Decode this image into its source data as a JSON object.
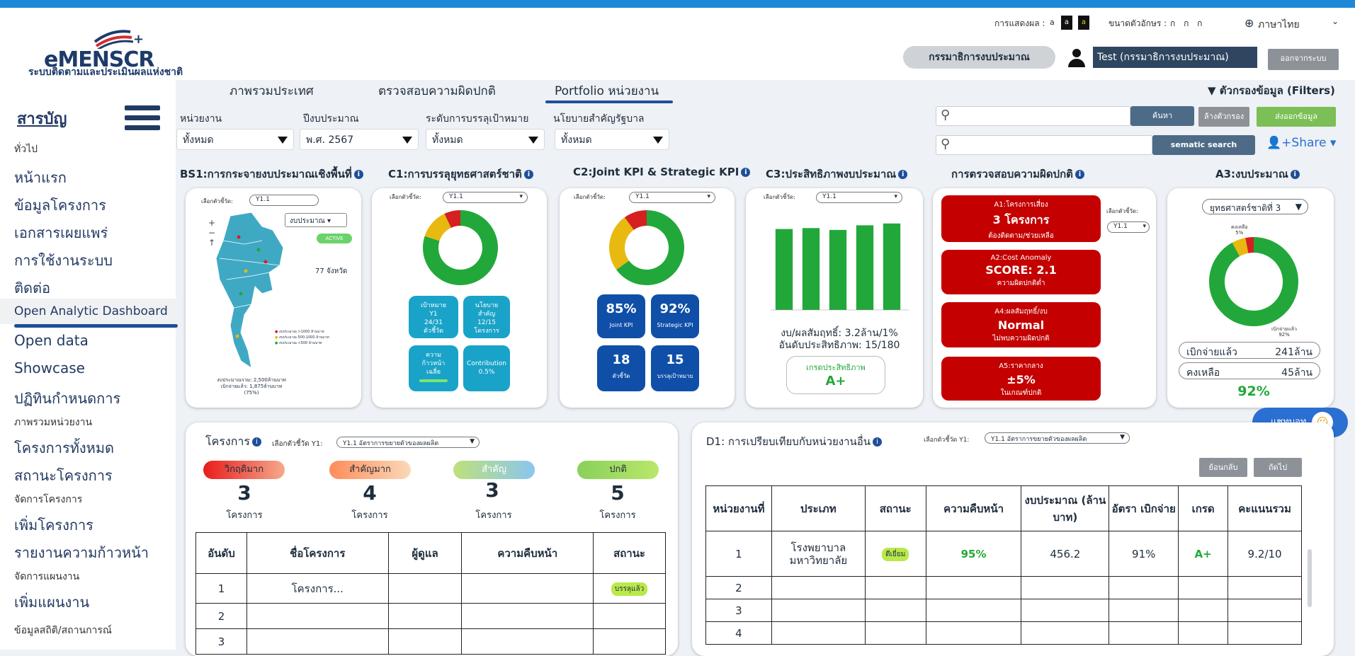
{
  "header": {
    "logo_text": "eMENSCR",
    "logo_sub": "ระบบติดตามและประเมินผลแห่งชาติ",
    "display_label": "การแสดงผล :",
    "fontsize_label": "ขนาดตัวอักษร :",
    "fontsize_options": "ก ก ก",
    "display_options": [
      "a",
      "a",
      "a"
    ],
    "language": "ภาษาไทย",
    "role_pill": "กรรมาธิการงบประมาณ",
    "user_name": "Test (กรรมาธิการงบประมาณ)",
    "logout": "ออกจากระบบ"
  },
  "sidebar": {
    "title": "สารบัญ",
    "items": [
      {
        "label": "ทั่วไป",
        "small": true
      },
      {
        "label": "หน้าแรก"
      },
      {
        "label": "ข้อมูลโครงการ"
      },
      {
        "label": "เอกสารเผยแพร่"
      },
      {
        "label": "การใช้งานระบบ"
      },
      {
        "label": "ติดต่อ"
      },
      {
        "label": "Open Analytic Dashboard",
        "active": true
      },
      {
        "label": "Open data"
      },
      {
        "label": "Showcase"
      },
      {
        "label": "ปฏิทินกำหนดการ"
      },
      {
        "label": "ภาพรวมหน่วยงาน",
        "small": true
      },
      {
        "label": "โครงการทั้งหมด"
      },
      {
        "label": "สถานะโครงการ"
      },
      {
        "label": "จัดการโครงการ",
        "small": true
      },
      {
        "label": "เพิ่มโครงการ"
      },
      {
        "label": "รายงานความก้าวหน้า"
      },
      {
        "label": "จัดการแผนงาน",
        "small": true
      },
      {
        "label": "เพิ่มแผนงาน"
      },
      {
        "label": "ข้อมูลสถิติ/สถานการณ์",
        "small": true
      }
    ]
  },
  "tabs": [
    "ภาพรวมประเทศ",
    "ตรวจสอบความผิดปกติ",
    "Portfolio หน่วยงาน"
  ],
  "filters_label": "ตัวกรองข้อมูล (Filters)",
  "filters": [
    {
      "label": "หน่วยงาน",
      "value": "ทั้งหมด"
    },
    {
      "label": "ปีงบประมาณ",
      "value": "พ.ศ. 2567"
    },
    {
      "label": "ระดับการบรรลุเป้าหมาย",
      "value": "ทั้งหมด"
    },
    {
      "label": "นโยบายสำคัญรัฐบาล",
      "value": "ทั้งหมด"
    }
  ],
  "search": {
    "btn": "ค้นหา",
    "clear": "ล้างตัวกรอง",
    "export": "ส่งออกข้อมูล",
    "semantic": "sematic search",
    "share": "Share"
  },
  "panels": {
    "bs1": "BS1:การกระจายงบประมาณเชิงพื้นที่",
    "c1": "C1:การบรรลุยุทธศาสตร์ชาติ",
    "c2": "C2:Joint KPI & Strategic KPI",
    "c3": "C3:ประสิทธิภาพงบประมาณ",
    "anom": "การตรวจสอบความผิดปกติ",
    "a3": "A3:งบประมาณ"
  },
  "bs1": {
    "selector_label": "เลือกตัวชี้วัด:",
    "selector_value": "Y1.1",
    "dropdown": "งบประมาณ",
    "active_tag": "ACTIVE",
    "province_count": "77 จังหวัด",
    "legend": [
      "งบประมาณ >1000 ล้านบาท",
      "งบประมาณ 500-1000 ล้านบาท",
      "งบประมาณ <500 ล้านบาท"
    ],
    "footer1": "งบประมาณรวม: 2,500ล้านบาท",
    "footer2": "เบิกจ่ายแล้ว: 1,875ล้านบาท",
    "footer3": "(75%)"
  },
  "c1": {
    "selector_label": "เลือกตัวชี้วัด:",
    "selector_value": "Y1.1",
    "donut": [
      {
        "name": "green",
        "value": 80,
        "color": "#22a83a"
      },
      {
        "name": "yellow",
        "value": 13,
        "color": "#e8b90e"
      },
      {
        "name": "red",
        "value": 7,
        "color": "#d42020"
      }
    ],
    "kpis": [
      {
        "l1": "เป้าหมาย",
        "l2": "Y1",
        "l3": "24/31",
        "l4": "ตัวชี้วัด"
      },
      {
        "l1": "นโยบาย",
        "l2": "สำคัญ",
        "l3": "12/15",
        "l4": "โครงการ"
      },
      {
        "l1": "ความ",
        "l2": "ก้าวหน้า",
        "l3": "เฉลี่ย",
        "l4": ""
      },
      {
        "l1": "Contribution",
        "l2": "0.5%",
        "l3": "",
        "l4": ""
      }
    ]
  },
  "c2": {
    "selector_label": "เลือกตัวชี้วัด:",
    "selector_value": "Y1.1",
    "donut": [
      {
        "name": "green",
        "value": 65,
        "color": "#22a83a"
      },
      {
        "name": "yellow",
        "value": 25,
        "color": "#e8b90e"
      },
      {
        "name": "red",
        "value": 10,
        "color": "#d42020"
      }
    ],
    "kpis": [
      {
        "value": "85%",
        "label": "Joint KPI"
      },
      {
        "value": "92%",
        "label": "Strategic KPI"
      },
      {
        "value": "18",
        "label": "ตัวชี้วัด"
      },
      {
        "value": "15",
        "label": "บรรลุเป้าหมาย"
      }
    ]
  },
  "c3": {
    "selector_label": "เลือกตัวชี้วัด:",
    "selector_value": "Y1.1",
    "chart_data": {
      "type": "bar",
      "categories": [
        "",
        "",
        "",
        "",
        ""
      ],
      "values": [
        88,
        89,
        87,
        92,
        94
      ],
      "ylim": [
        0,
        100
      ],
      "color": "#22a83a"
    },
    "line1": "งบ/ผลสัมฤทธิ์: 3.2ล้าน/1%",
    "line2": "อันดับประสิทธิภาพ: 15/180",
    "grade_label": "เกรดประสิทธิภาพ",
    "grade": "A+"
  },
  "anomaly": {
    "selector_label": "เลือกตัวชี้วัด:",
    "selector_value": "Y1.1",
    "boxes": [
      {
        "t": "A1:โครงการเสี่ยง",
        "v": "3 โครงการ",
        "s": "ต้องติดตาม/ช่วยเหลือ"
      },
      {
        "t": "A2:Cost Anomaly",
        "v": "SCORE: 2.1",
        "s": "ความผิดปกติต่ำ"
      },
      {
        "t": "A4:ผลสัมฤทธิ์/งบ",
        "v": "Normal",
        "s": "ไม่พบความผิดปกติ"
      },
      {
        "t": "A5:ราคากลาง",
        "v": "±5%",
        "s": "ในเกณฑ์ปกติ"
      }
    ]
  },
  "a3": {
    "select": "ยุทธศาสตร์ชาติที่ 3",
    "donut": [
      {
        "name": "green",
        "value": 92,
        "color": "#22a83a"
      },
      {
        "name": "yellow",
        "value": 5,
        "color": "#e8b90e"
      },
      {
        "name": "red",
        "value": 3,
        "color": "#d42020"
      }
    ],
    "lbl_top": "คงเหลือ",
    "lbl_top2": "5%",
    "lbl_bottom": "เบิกจ่ายแล้ว",
    "lbl_bottom2": "92%",
    "spent_label": "เบิกจ่ายแล้ว",
    "spent_value": "241ล้าน",
    "remain_label": "คงเหลือ",
    "remain_value": "45ล้าน",
    "pct": "92%"
  },
  "projects": {
    "title": "โครงการ",
    "selector_label": "เลือกตัวชี้วัด Y1:",
    "selector_value": "Y1.1 อัตราการขยายตัวของผลผลิต",
    "stats": [
      {
        "label": "วิกฤติมาก",
        "count": "3",
        "unit": "โครงการ"
      },
      {
        "label": "สำคัญมาก",
        "count": "4",
        "unit": "โครงการ"
      },
      {
        "label": "สำคัญ",
        "count": "3",
        "unit": "โครงการ"
      },
      {
        "label": "ปกติ",
        "count": "5",
        "unit": "โครงการ"
      }
    ],
    "columns": [
      "อันดับ",
      "ชื่อโครงการ",
      "ผู้ดูแล",
      "ความคืบหน้า",
      "สถานะ"
    ],
    "rows": [
      {
        "rank": "1",
        "name": "โครงการ...",
        "status": "บรรลุแล้ว"
      },
      {
        "rank": "2",
        "name": "",
        "status": ""
      },
      {
        "rank": "3",
        "name": "",
        "status": ""
      }
    ]
  },
  "compare": {
    "title": "D1: การเปรียบเทียบกับหน่วยงานอื่น",
    "selector_label": "เลือกตัวชี้วัด Y1:",
    "selector_value": "Y1.1 อัตราการขยายตัวของผลผลิต",
    "prev": "ย้อนกลับ",
    "next": "ถัดไป",
    "columns": [
      "หน่วยงานที่",
      "ประเภท",
      "สถานะ",
      "ความคืบหน้า",
      "งบประมาณ (ล้านบาท)",
      "อัตรา เบิกจ่าย",
      "เกรด",
      "คะแนนรวม"
    ],
    "rows": [
      {
        "no": "1",
        "type": "โรงพยาบาล มหาวิทยาลัย",
        "status": "ดีเยี่ยม",
        "progress": "95%",
        "budget": "456.2",
        "rate": "91%",
        "grade": "A+",
        "score": "9.2/10"
      },
      {
        "no": "2"
      },
      {
        "no": "3"
      },
      {
        "no": "4"
      }
    ]
  },
  "float_btn": "แชทบอท"
}
